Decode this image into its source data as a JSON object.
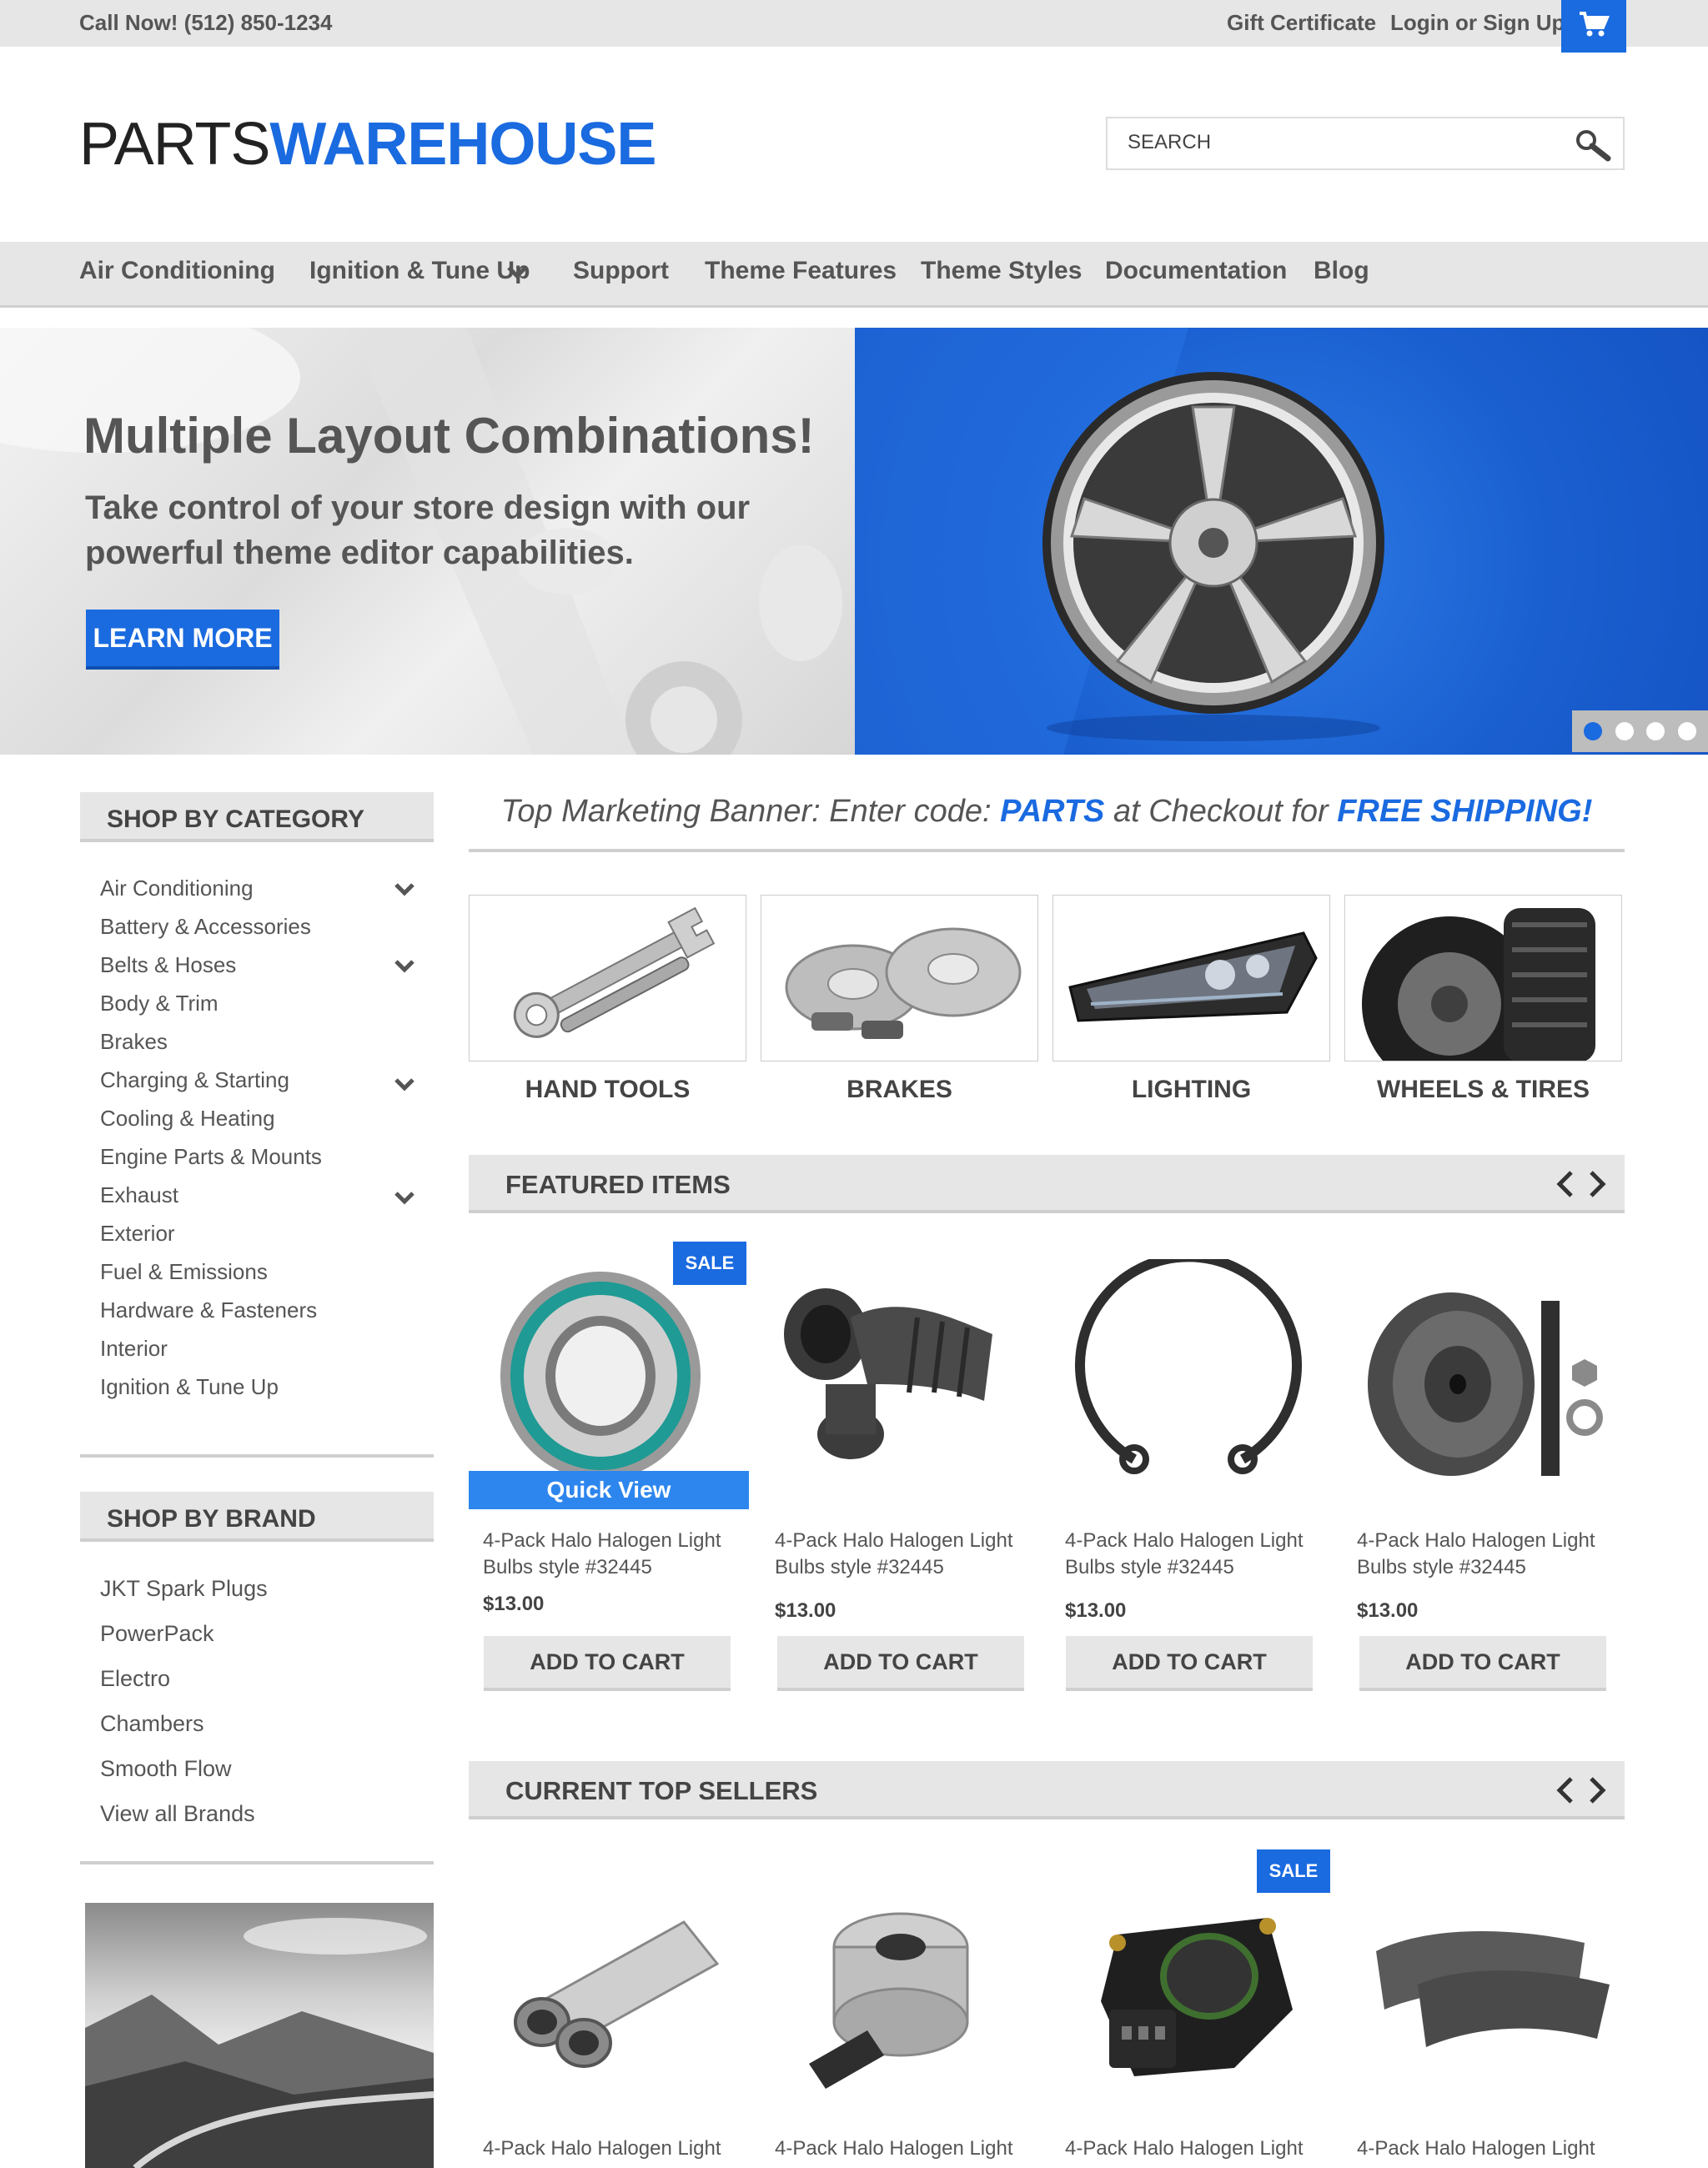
{
  "topbar": {
    "phone": "Call Now! (512) 850-1234",
    "gift_certificate": "Gift Certificate",
    "login": "Login or Sign Up",
    "cart_icon": "cart-icon"
  },
  "header": {
    "logo_part1": "PARTS",
    "logo_part2": "WAREHOUSE",
    "search_placeholder": "SEARCH",
    "search_icon": "magnifier-icon"
  },
  "nav": {
    "items": [
      {
        "label": "Air Conditioning"
      },
      {
        "label": "Ignition & Tune Up"
      },
      {
        "label": "Support"
      },
      {
        "label": "Theme Features"
      },
      {
        "label": "Theme Styles"
      },
      {
        "label": "Documentation"
      },
      {
        "label": "Blog"
      }
    ]
  },
  "hero": {
    "title": "Multiple Layout Combinations!",
    "subtitle": "Take control of your store design with our powerful theme editor capabilities.",
    "button": "LEARN MORE",
    "active_slide": 1,
    "slide_count": 4
  },
  "sidebar": {
    "category_heading": "SHOP BY CATEGORY",
    "categories": [
      {
        "label": "Air Conditioning",
        "expandable": true
      },
      {
        "label": "Battery & Accessories",
        "expandable": false
      },
      {
        "label": "Belts & Hoses",
        "expandable": true
      },
      {
        "label": "Body & Trim",
        "expandable": false
      },
      {
        "label": "Brakes",
        "expandable": false
      },
      {
        "label": "Charging & Starting",
        "expandable": true
      },
      {
        "label": "Cooling & Heating",
        "expandable": false
      },
      {
        "label": "Engine Parts & Mounts",
        "expandable": false
      },
      {
        "label": "Exhaust",
        "expandable": true
      },
      {
        "label": "Exterior",
        "expandable": false
      },
      {
        "label": "Fuel & Emissions",
        "expandable": false
      },
      {
        "label": "Hardware & Fasteners",
        "expandable": false
      },
      {
        "label": "Interior",
        "expandable": false
      },
      {
        "label": "Ignition & Tune Up",
        "expandable": false
      }
    ],
    "brand_heading": "SHOP BY BRAND",
    "brands": [
      {
        "label": "JKT Spark Plugs"
      },
      {
        "label": "PowerPack"
      },
      {
        "label": "Electro"
      },
      {
        "label": "Chambers"
      },
      {
        "label": "Smooth Flow"
      },
      {
        "label": "View all Brands"
      }
    ]
  },
  "marketing": {
    "prefix": "Top Marketing Banner: Enter code: ",
    "code": "PARTS",
    "middle": " at Checkout for ",
    "offer": "FREE SHIPPING!"
  },
  "category_tiles": [
    {
      "label": "HAND TOOLS",
      "icon": "wrench-icon"
    },
    {
      "label": "BRAKES",
      "icon": "brake-rotor-icon"
    },
    {
      "label": "LIGHTING",
      "icon": "headlight-icon"
    },
    {
      "label": "WHEELS & TIRES",
      "icon": "tire-icon"
    }
  ],
  "featured": {
    "heading": "FEATURED ITEMS",
    "quick_view": "Quick View",
    "sale_label": "SALE",
    "add_to_cart": "ADD TO CART",
    "products": [
      {
        "name": "4-Pack Halo Halogen Light Bulbs style #32445",
        "price": "$13.00",
        "sale": true,
        "icon": "bearing-icon"
      },
      {
        "name": "4-Pack Halo Halogen Light Bulbs style #32445",
        "price": "$13.00",
        "sale": false,
        "icon": "intake-hose-icon"
      },
      {
        "name": "4-Pack Halo Halogen Light Bulbs style #32445",
        "price": "$13.00",
        "sale": false,
        "icon": "snap-ring-icon"
      },
      {
        "name": "4-Pack Halo Halogen Light Bulbs style #32445",
        "price": "$13.00",
        "sale": false,
        "icon": "pulley-icon"
      }
    ]
  },
  "top_sellers": {
    "heading": "CURRENT TOP SELLERS",
    "sale_label": "SALE",
    "products": [
      {
        "name": "4-Pack Halo Halogen Light",
        "icon": "exhaust-tip-icon"
      },
      {
        "name": "4-Pack Halo Halogen Light",
        "icon": "vacuum-canister-icon"
      },
      {
        "name": "4-Pack Halo Halogen Light",
        "icon": "throttle-sensor-icon",
        "sale": true
      },
      {
        "name": "4-Pack Halo Halogen Light",
        "icon": "brake-pads-icon"
      }
    ]
  },
  "colors": {
    "accent": "#1a6ae0",
    "bar": "#e6e6e6",
    "text": "#444444"
  }
}
